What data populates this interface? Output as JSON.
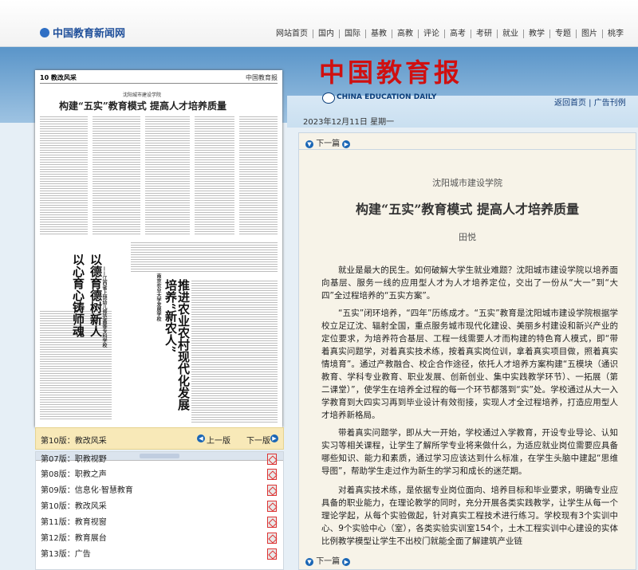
{
  "site": {
    "logo_text": "中国教育新闻网",
    "nav": [
      "网站首页",
      "国内",
      "国际",
      "基教",
      "高教",
      "评论",
      "高考",
      "考研",
      "就业",
      "教学",
      "专题",
      "图片",
      "桃李"
    ]
  },
  "masthead": {
    "title": "中国教育报",
    "en": "CHINA EDUCATION DAILY",
    "links": [
      "返回首页",
      "广告刊例"
    ],
    "date": "2023年12月11日 星期一"
  },
  "paper_preview": {
    "page_label": "10 教改风采",
    "header_right": "中国教育报",
    "sub": "沈阳城市建设学院",
    "title": "构建“五实”教育模式 提高人才培养质量",
    "vertical_title_1": "以心育心铸师魂",
    "vertical_title_2": "以德育德树新人",
    "vertical_sub": "——江西省上饶幼儿师范高等专科学校",
    "vertical_mid_1": "培养“新农人”",
    "vertical_mid_2": "推进农业农村现代化发展",
    "vertical_mid_sub": "南京农业大学发展学校"
  },
  "page_nav": {
    "current": "第10版：教改风采",
    "prev": "上一版",
    "next": "下一版"
  },
  "page_list": [
    {
      "label": "第07版：职教视野"
    },
    {
      "label": "第08版：职教之声"
    },
    {
      "label": "第09版：信息化·智慧教育"
    },
    {
      "label": "第10版：教改风采"
    },
    {
      "label": "第11版：教育视窗"
    },
    {
      "label": "第12版：教育展台"
    },
    {
      "label": "第13版：广告"
    }
  ],
  "article": {
    "nav_top": "下一篇",
    "nav_bottom": "下一篇",
    "subtitle": "沈阳城市建设学院",
    "title": "构建“五实”教育模式 提高人才培养质量",
    "author": "田悦",
    "paragraphs": [
      "就业是最大的民生。如何破解大学生就业难题？沈阳城市建设学院以培养面向基层、服务一线的应用型人才为人才培养定位，交出了一份从“大一”到“大四”全过程培养的“五实方案”。",
      "“五实”闭环培养，“四年”历练成才。“五实”教育是沈阳城市建设学院根据学校立足辽沈、辐射全国，重点服务城市现代化建设、美丽乡村建设和新兴产业的定位要求，为培养符合基层、工程一线需要人才而构建的特色育人模式，即“带着真实问题学，对着真实技术练，按着真实岗位训，拿着真实项目做，照着真实情境育”。通过产教融合、校企合作途径，依托人才培养方案构建“五模块（通识教育、学科专业教育、职业发展、创新创业、集中实践教学环节）、一拓展（第二课堂）”，使学生在培养全过程的每一个环节都落到“实”处。学校通过从大一入学教育到大四实习再到毕业设计有效衔接，实现人才全过程培养，打造应用型人才培养新格局。",
      "带着真实问题学，即从大一开始，学校通过入学教育，开设专业导论、认知实习等相关课程，让学生了解所学专业将来做什么，为适应就业岗位需要应具备哪些知识、能力和素质，通过学习应该达到什么标准，在学生头脑中建起“思维导图”，帮助学生走过作为新生的学习和成长的迷茫期。",
      "对着真实技术练，是依据专业岗位面向、培养目标和毕业要求，明确专业应具备的职业能力，在理论教学的同时，充分开展各类实践教学，让学生从每一个理论学起，从每个实验做起，针对真实工程技术进行练习。学校现有3个实训中心、9个实验中心（室），各类实验实训室154个，土木工程实训中心建设的实体比例教学模型让学生不出校门就能全面了解建筑产业链"
    ]
  },
  "colors": {
    "accent_blue": "#1a66b5",
    "masthead_red": "#d01010",
    "nav_bg": "#f8e9b8"
  }
}
